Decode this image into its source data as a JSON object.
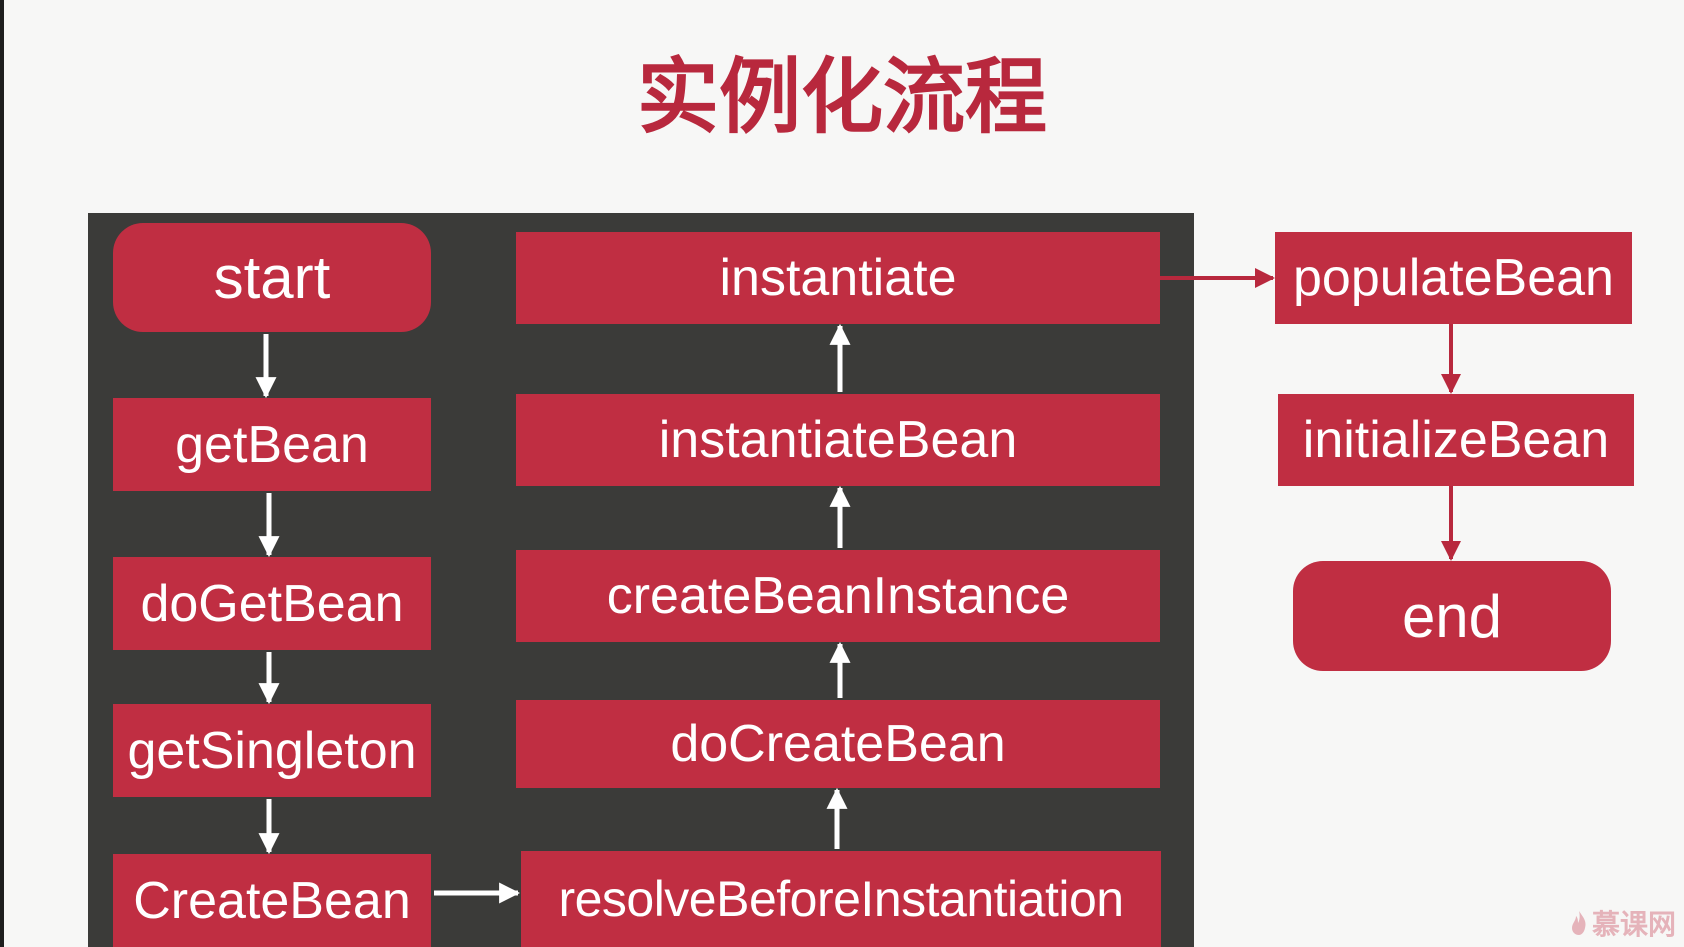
{
  "title": "实例化流程",
  "nodes": {
    "start": "start",
    "getBean": "getBean",
    "doGetBean": "doGetBean",
    "getSingleton": "getSingleton",
    "createBean": "CreateBean",
    "resolveBeforeInstantiation": "resolveBeforeInstantiation",
    "doCreateBean": "doCreateBean",
    "createBeanInstance": "createBeanInstance",
    "instantiateBean": "instantiateBean",
    "instantiate": "instantiate",
    "populateBean": "populateBean",
    "initializeBean": "initializeBean",
    "end": "end"
  },
  "watermark": "慕课网",
  "colors": {
    "accent": "#c02e42",
    "title": "#b8283d",
    "panel": "#3b3b39",
    "background": "#f7f7f6",
    "arrow_in_panel": "#ffffff",
    "arrow_outside": "#b8283d"
  }
}
